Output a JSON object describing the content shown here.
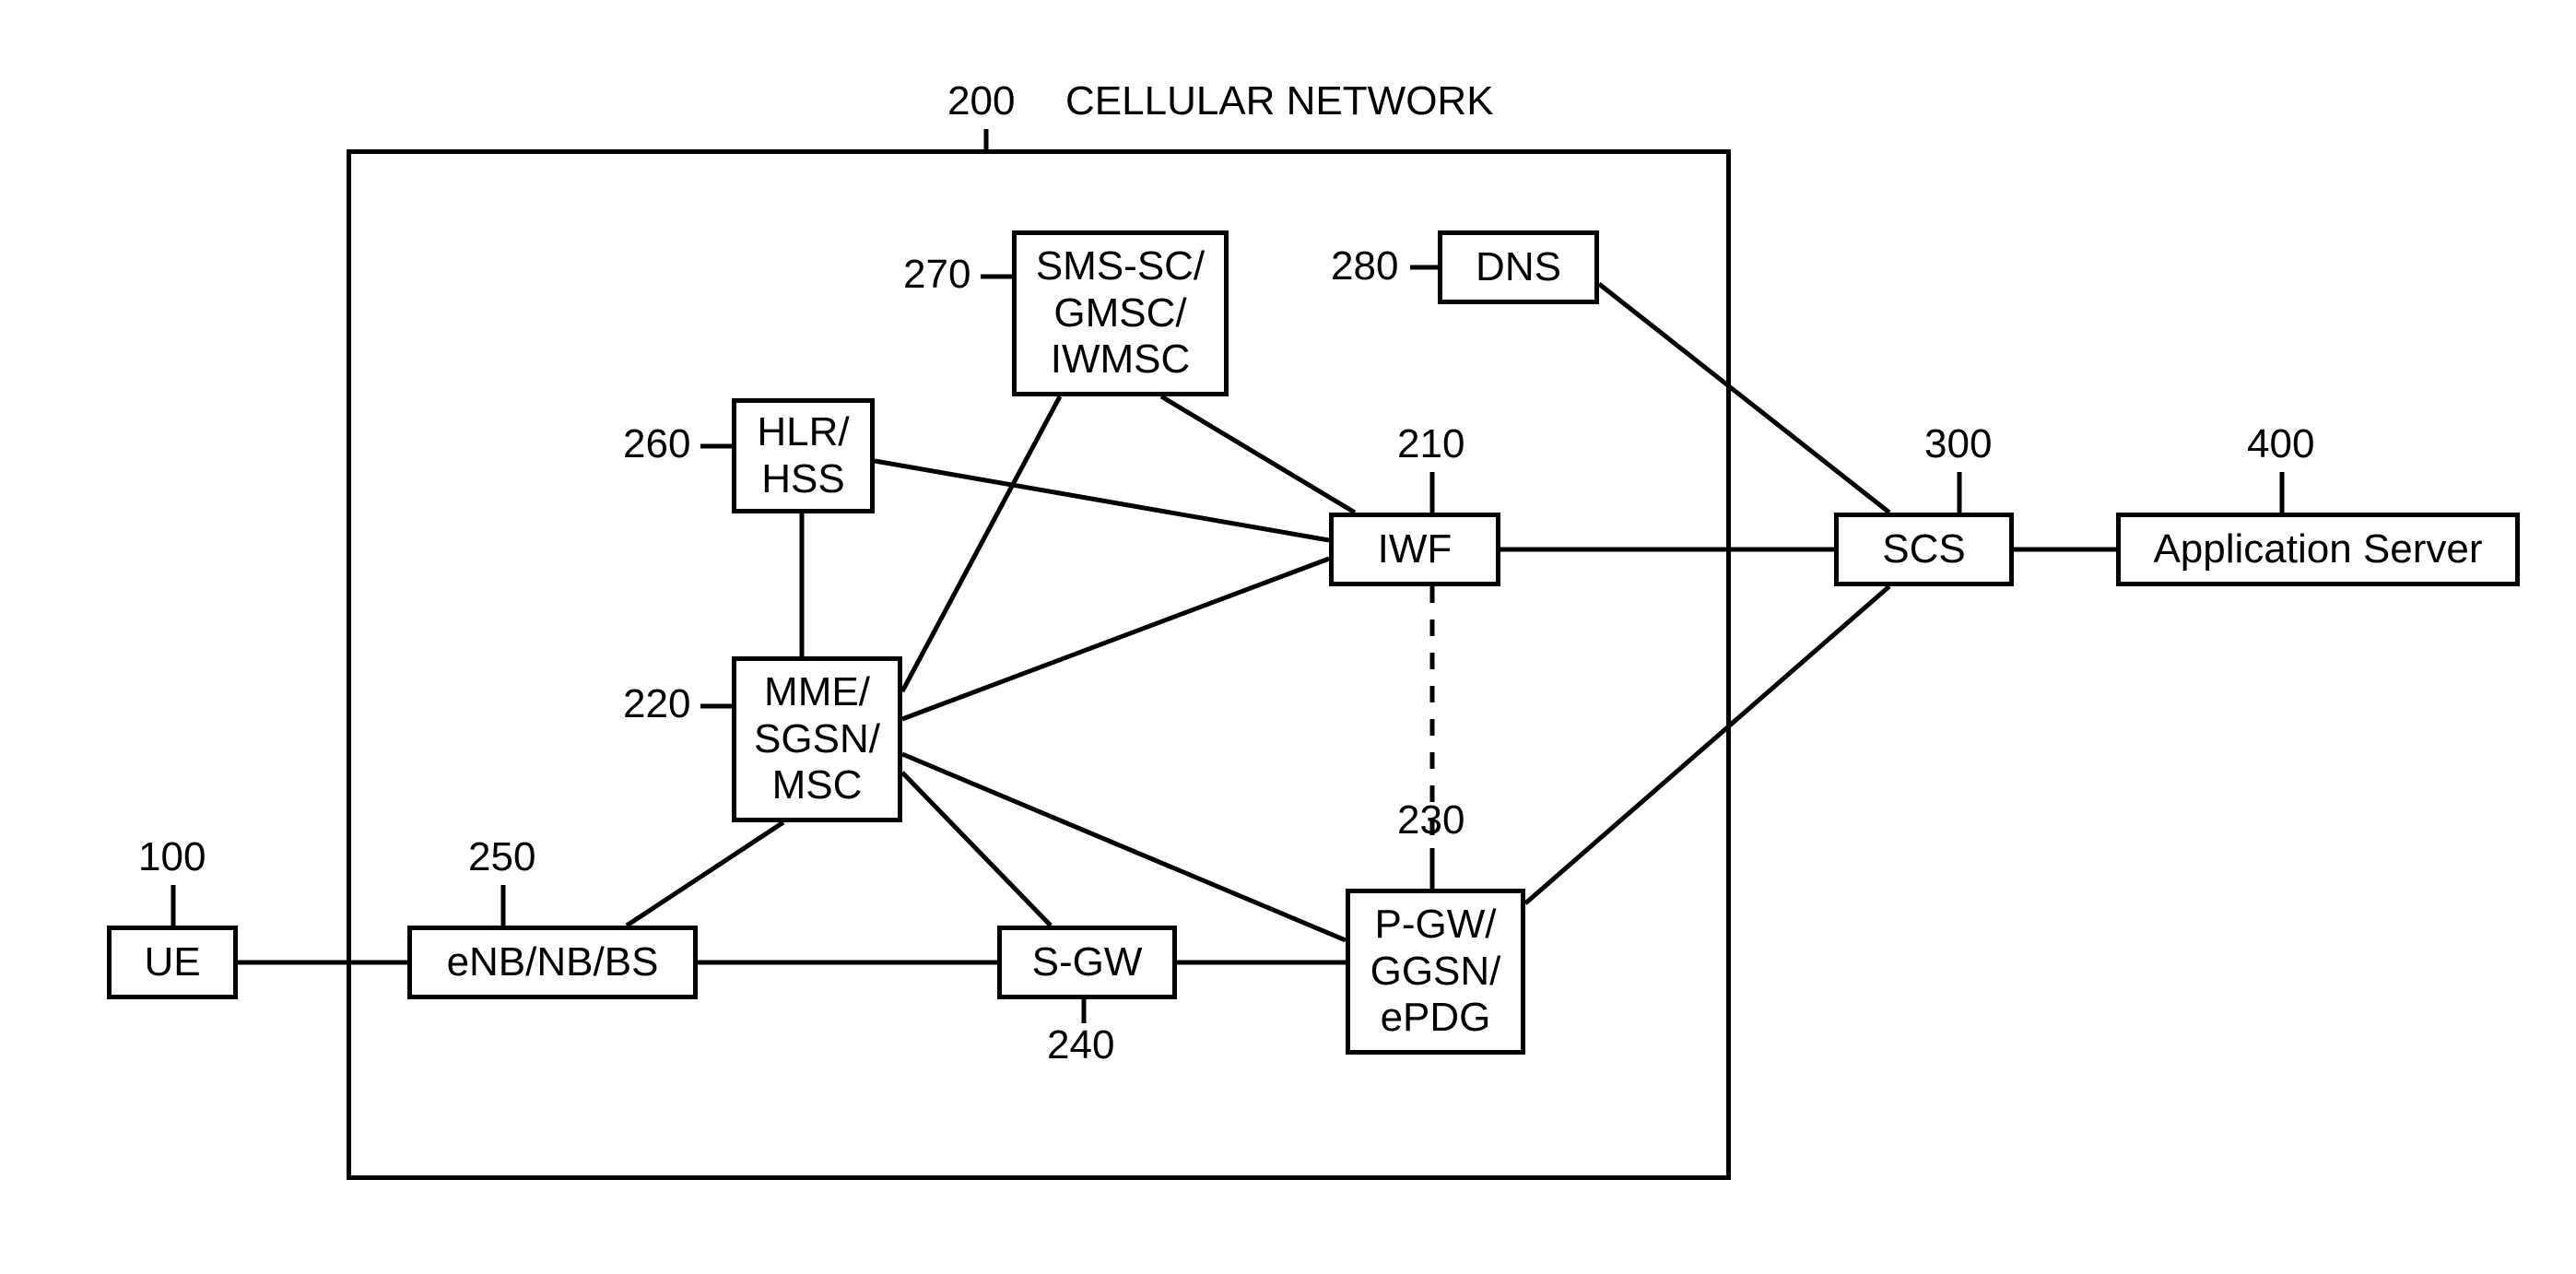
{
  "title_ref": "200",
  "title_text": "CELLULAR NETWORK",
  "ue": {
    "ref": "100",
    "label": "UE"
  },
  "enb": {
    "ref": "250",
    "label": "eNB/NB/BS"
  },
  "mme": {
    "ref": "220",
    "label": "MME/\nSGSN/\nMSC"
  },
  "hlr": {
    "ref": "260",
    "label": "HLR/\nHSS"
  },
  "sms": {
    "ref": "270",
    "label": "SMS-SC/\nGMSC/\nIWMSC"
  },
  "dns": {
    "ref": "280",
    "label": "DNS"
  },
  "iwf": {
    "ref": "210",
    "label": "IWF"
  },
  "sgw": {
    "ref": "240",
    "label": "S-GW"
  },
  "pgw": {
    "ref": "230",
    "label": "P-GW/\nGGSN/\nePDG"
  },
  "scs": {
    "ref": "300",
    "label": "SCS"
  },
  "app": {
    "ref": "400",
    "label": "Application Server"
  }
}
